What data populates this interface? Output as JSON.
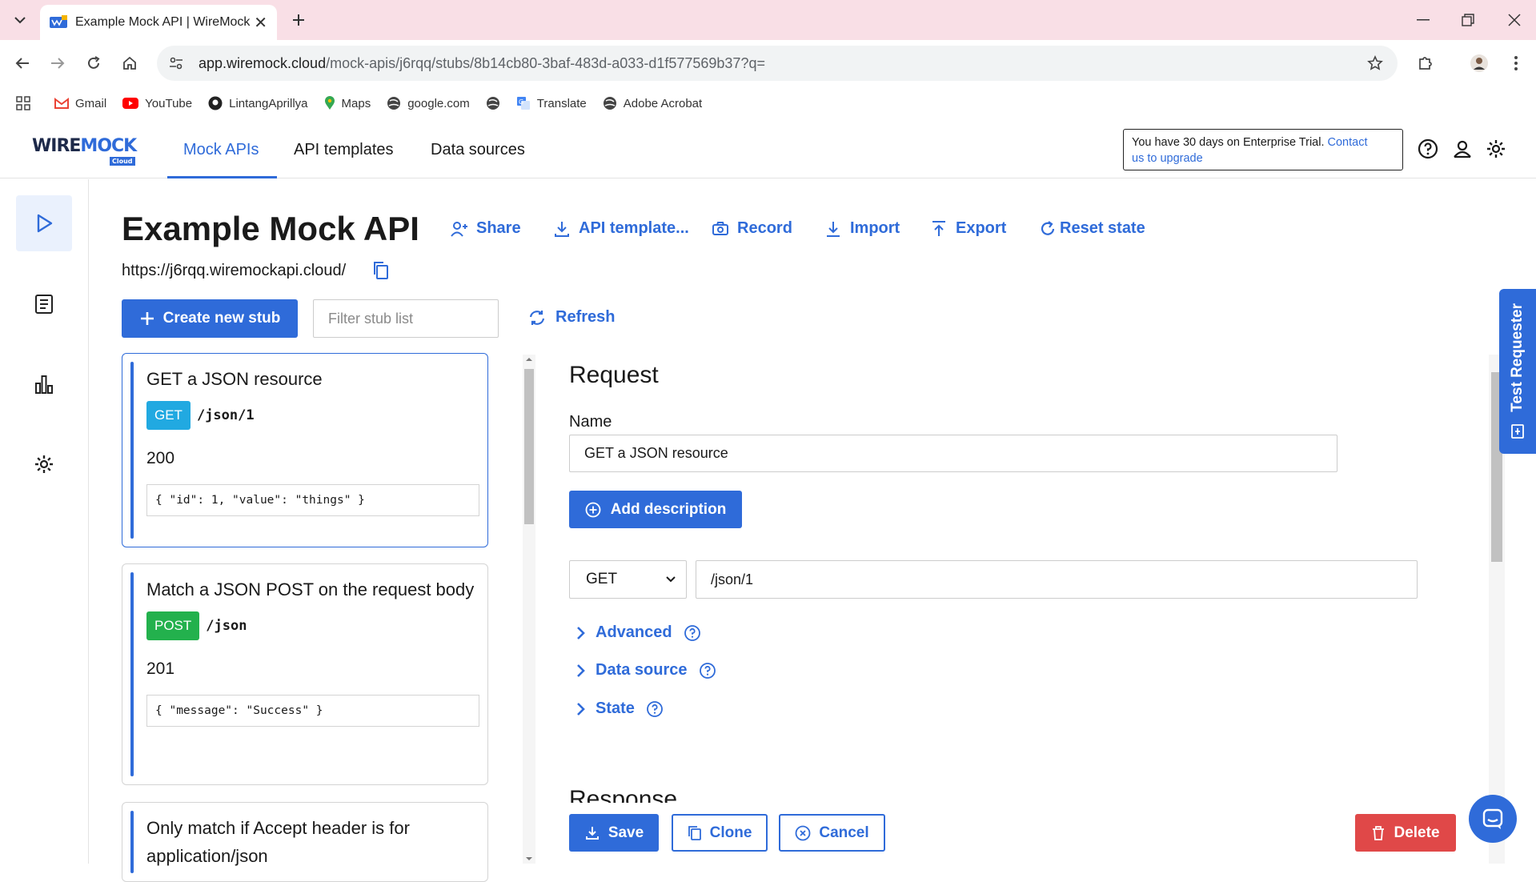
{
  "browser": {
    "tab_title": "Example Mock API | WireMock",
    "url_host": "app.wiremock.cloud",
    "url_path": "/mock-apis/j6rqq/stubs/8b14cb80-3baf-483d-a033-d1f577569b37?q=",
    "bookmarks": [
      {
        "label": "Gmail",
        "icon": "gmail-icon",
        "color": "#ea4335"
      },
      {
        "label": "YouTube",
        "icon": "youtube-icon",
        "color": "#ff0000"
      },
      {
        "label": "LintangAprillya",
        "icon": "github-icon",
        "color": "#222222"
      },
      {
        "label": "Maps",
        "icon": "maps-icon",
        "color": "#34a853"
      },
      {
        "label": "google.com",
        "icon": "globe-icon",
        "color": "#333333"
      },
      {
        "label": "",
        "icon": "globe-icon",
        "color": "#333333"
      },
      {
        "label": "Translate",
        "icon": "translate-icon",
        "color": "#4285f4"
      },
      {
        "label": "Adobe Acrobat",
        "icon": "globe-icon",
        "color": "#333333"
      }
    ]
  },
  "header": {
    "logo_wire": "WIRE",
    "logo_mock": "MOCK",
    "logo_cloud": "Cloud",
    "nav": [
      "Mock APIs",
      "API templates",
      "Data sources"
    ],
    "trial_text": "You have 30 days on Enterprise Trial.",
    "trial_link_1": "Contact",
    "trial_link_2": "us to upgrade"
  },
  "page": {
    "title": "Example Mock API",
    "url": "https://j6rqq.wiremockapi.cloud/",
    "actions": {
      "share": "Share",
      "api_template": "API template...",
      "record": "Record",
      "import": "Import",
      "export": "Export",
      "reset": "Reset state"
    },
    "create_stub": "Create new stub",
    "filter_placeholder": "Filter stub list",
    "refresh": "Refresh"
  },
  "stubs": [
    {
      "name": "GET a JSON resource",
      "method": "GET",
      "path": "/json/1",
      "status": "200",
      "body": "{ \"id\": 1, \"value\": \"things\" }"
    },
    {
      "name": "Match a JSON POST on the request body",
      "method": "POST",
      "path": "/json",
      "status": "201",
      "body": "{ \"message\": \"Success\" }"
    },
    {
      "name": "Only match if Accept header is for application/json"
    }
  ],
  "request": {
    "title": "Request",
    "name_label": "Name",
    "name_value": "GET a JSON resource",
    "add_description": "Add description",
    "method": "GET",
    "url": "/json/1",
    "advanced": "Advanced",
    "data_source": "Data source",
    "state": "State",
    "response_title": "Response"
  },
  "footer": {
    "save": "Save",
    "clone": "Clone",
    "cancel": "Cancel",
    "delete": "Delete"
  },
  "side_tab": "Test Requester",
  "colors": {
    "accent": "#2f6bd9",
    "get_badge": "#21a9e1",
    "post_badge": "#23b14d",
    "danger": "#e04848",
    "tabbar": "#f9dfe6"
  }
}
